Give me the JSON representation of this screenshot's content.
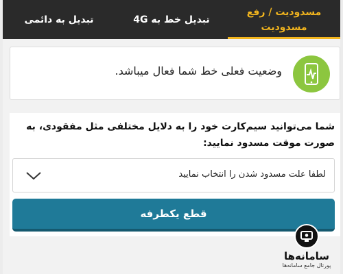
{
  "tabs": [
    {
      "label": "مسدودیت / رفع مسدودیت",
      "active": true
    },
    {
      "label": "تبدیل خط به 4G",
      "active": false
    },
    {
      "label": "تبدیل به دائمی",
      "active": false
    }
  ],
  "status": {
    "icon": "phone-activity-icon",
    "text": "وضعیت فعلی خط شما فعال میباشد."
  },
  "block_form": {
    "info": "شما می‌توانید سیم‌کارت خود را به دلایل مختلفی مثل مفقودی، به صورت موقت مسدود نمایید:",
    "select_value": "لطفا علت مسدود شدن را انتخاب نمایید",
    "submit_label": "قطع یکطرفه"
  },
  "watermark": {
    "name": "سامانه‌ها",
    "subtitle": "پورتال جامع سامانه‌ها"
  },
  "colors": {
    "tab_bar": "#2a2a2a",
    "accent": "#f2b51e",
    "status_green": "#8cc63f",
    "button": "#1f7a98"
  }
}
